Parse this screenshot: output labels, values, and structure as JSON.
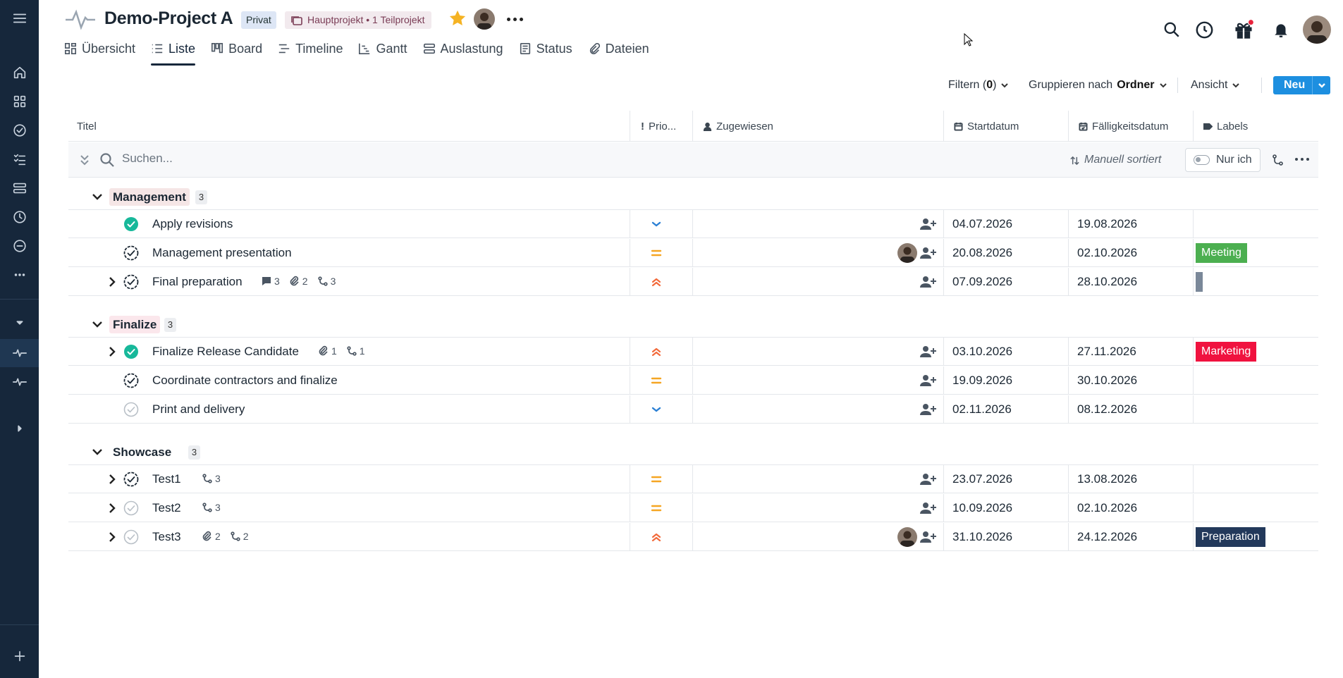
{
  "project": {
    "title": "Demo-Project A",
    "privacy_badge": "Privat",
    "hierarchy_badge": "Hauptprojekt • 1 Teilprojekt"
  },
  "tabs": [
    {
      "label": "Übersicht",
      "icon": "overview-icon"
    },
    {
      "label": "Liste",
      "icon": "list-icon",
      "active": true
    },
    {
      "label": "Board",
      "icon": "board-icon"
    },
    {
      "label": "Timeline",
      "icon": "timeline-icon"
    },
    {
      "label": "Gantt",
      "icon": "gantt-icon"
    },
    {
      "label": "Auslastung",
      "icon": "workload-icon"
    },
    {
      "label": "Status",
      "icon": "status-icon"
    },
    {
      "label": "Dateien",
      "icon": "paperclip-icon"
    }
  ],
  "toolbar": {
    "filter_prefix": "Filtern (",
    "filter_count": "0",
    "filter_suffix": ")",
    "group_prefix": "Gruppieren nach",
    "group_value": "Ordner",
    "view_label": "Ansicht",
    "new_label": "Neu"
  },
  "columns": {
    "title": "Titel",
    "priority": "Prio...",
    "assigned": "Zugewiesen",
    "start": "Startdatum",
    "due": "Fälligkeitsdatum",
    "labels": "Labels"
  },
  "search": {
    "placeholder": "Suchen...",
    "sort_label": "Manuell sortiert",
    "only_me_label": "Nur ich"
  },
  "groups": [
    {
      "name": "Management",
      "count": "3",
      "highlight": "#f5e6e6",
      "tasks": [
        {
          "title": "Apply revisions",
          "status": "done",
          "expandable": false,
          "priority": "low",
          "avatar": false,
          "start": "04.07.2026",
          "due": "19.08.2026",
          "label": null,
          "meta": {}
        },
        {
          "title": "Management presentation",
          "status": "in-progress",
          "expandable": false,
          "priority": "medium",
          "avatar": true,
          "start": "20.08.2026",
          "due": "02.10.2026",
          "label": {
            "text": "Meeting",
            "color": "#4caf50"
          },
          "meta": {}
        },
        {
          "title": "Final preparation",
          "status": "in-progress",
          "expandable": true,
          "priority": "high",
          "avatar": false,
          "start": "07.09.2026",
          "due": "28.10.2026",
          "label": {
            "text": "",
            "color": "#7a8899"
          },
          "meta": {
            "comments": "3",
            "attachments": "2",
            "subtasks": "3"
          }
        }
      ]
    },
    {
      "name": "Finalize",
      "count": "3",
      "highlight": "#fbe7ec",
      "tasks": [
        {
          "title": "Finalize Release Candidate",
          "status": "done",
          "expandable": true,
          "priority": "high",
          "avatar": false,
          "start": "03.10.2026",
          "due": "27.11.2026",
          "label": {
            "text": "Marketing",
            "color": "#f0123f"
          },
          "meta": {
            "attachments": "1",
            "subtasks": "1"
          }
        },
        {
          "title": "Coordinate contractors and finalize",
          "status": "in-progress",
          "expandable": false,
          "priority": "medium",
          "avatar": false,
          "start": "19.09.2026",
          "due": "30.10.2026",
          "label": null,
          "meta": {}
        },
        {
          "title": "Print and delivery",
          "status": "open",
          "expandable": false,
          "priority": "low",
          "avatar": false,
          "start": "02.11.2026",
          "due": "08.12.2026",
          "label": null,
          "meta": {}
        }
      ]
    },
    {
      "name": "Showcase",
      "count": "3",
      "highlight": "transparent",
      "tasks": [
        {
          "title": "Test1",
          "status": "in-progress",
          "expandable": true,
          "priority": "medium",
          "avatar": false,
          "start": "23.07.2026",
          "due": "13.08.2026",
          "label": null,
          "meta": {
            "subtasks": "3"
          }
        },
        {
          "title": "Test2",
          "status": "open",
          "expandable": true,
          "priority": "medium",
          "avatar": false,
          "start": "10.09.2026",
          "due": "02.10.2026",
          "label": null,
          "meta": {
            "subtasks": "3"
          }
        },
        {
          "title": "Test3",
          "status": "open",
          "expandable": true,
          "priority": "high",
          "avatar": true,
          "start": "31.10.2026",
          "due": "24.12.2026",
          "label": {
            "text": "Preparation",
            "color": "#23395b"
          },
          "meta": {
            "attachments": "2",
            "subtasks": "2"
          }
        }
      ]
    }
  ],
  "colors": {
    "nav_bg": "#16273b",
    "accent": "#1d8fe0",
    "done": "#17b89a",
    "prio_low": "#2a7fd4",
    "prio_medium": "#f5a623",
    "prio_high": "#f26a3b",
    "star": "#f5b323",
    "notification": "#e8233c"
  }
}
